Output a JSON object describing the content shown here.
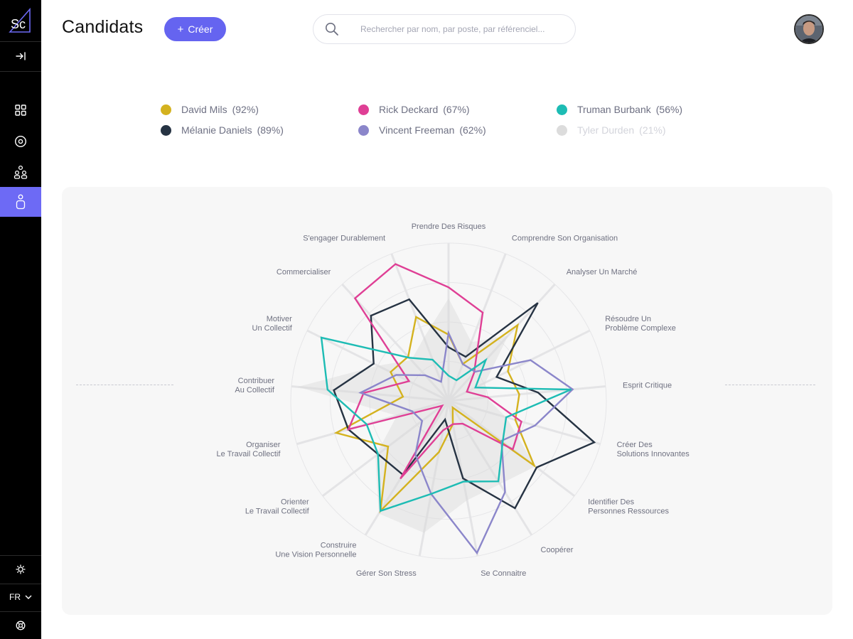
{
  "app": {
    "logo_text": "Sc"
  },
  "header": {
    "title": "Candidats",
    "create_label": "Créer",
    "search_placeholder": "Rechercher par nom, par poste, par référenciel..."
  },
  "sidebar": {
    "language": "FR",
    "items": [
      {
        "name": "collapse",
        "icon": "collapse-arrow-icon"
      },
      {
        "name": "dashboard",
        "icon": "grid-icon"
      },
      {
        "name": "target",
        "icon": "target-icon"
      },
      {
        "name": "team",
        "icon": "team-icon"
      },
      {
        "name": "candidates",
        "icon": "person-icon",
        "active": true
      }
    ],
    "bottom": [
      {
        "name": "settings",
        "icon": "gear-icon"
      },
      {
        "name": "support",
        "icon": "lifebuoy-icon"
      }
    ]
  },
  "colors": {
    "accent": "#6564f0",
    "sidebar_bg": "#000000",
    "panel_bg": "#f7f7f7"
  },
  "chart_data": {
    "type": "radar",
    "axes": [
      "Prendre Des Risques",
      "Comprendre Son Organisation",
      "Analyser Un Marché",
      "Résoudre Un|Problème Complexe",
      "Esprit Critique",
      "Créer Des|Solutions Innovantes",
      "Identifier Des|Personnes Ressources",
      "Coopérer",
      "Se Connaitre",
      "Gérer Son Stress",
      "Construire|Une Vision Personnelle",
      "Orienter|Le Travail Collectif",
      "Organiser|Le Travail  Collectif",
      "Contribuer|Au Collectif",
      "Motiver|Un Collectif",
      "Commercialiser",
      "S'engager Durablement"
    ],
    "rmax": 10,
    "grid_rings": [
      2.5,
      5,
      7.5,
      10
    ],
    "series": [
      {
        "name": "David Mils",
        "score": "(92%)",
        "color": "#d4b21f",
        "visible": true,
        "values": [
          4.2,
          2.5,
          6.5,
          4.2,
          4.5,
          4.4,
          6.8,
          0.5,
          1.5,
          3.3,
          8.2,
          4.8,
          7.4,
          2.9,
          4.1,
          3.8,
          5.7
        ]
      },
      {
        "name": "Mélanie Daniels",
        "score": "(89%)",
        "color": "#263343",
        "visible": true,
        "values": [
          3.4,
          3.0,
          8.4,
          3.4,
          5.7,
          9.6,
          7.0,
          8.0,
          5.0,
          1.2,
          5.5,
          5.6,
          6.6,
          7.3,
          5.3,
          7.3,
          6.9
        ]
      },
      {
        "name": "Rick Deckard",
        "score": "(67%)",
        "color": "#df3f95",
        "visible": true,
        "values": [
          7.2,
          6.0,
          2.4,
          1.3,
          2.5,
          4.8,
          5.1,
          1.7,
          1.5,
          1.9,
          5.8,
          0.5,
          6.6,
          5.4,
          2.8,
          8.8,
          9.3
        ]
      },
      {
        "name": "Vincent Freeman",
        "score": "(62%)",
        "color": "#8b86ca",
        "visible": true,
        "values": [
          4.3,
          2.5,
          2.5,
          5.8,
          7.9,
          5.7,
          4.2,
          6.8,
          9.8,
          6.0,
          4.0,
          2.1,
          2.4,
          5.6,
          3.7,
          2.2,
          1.3
        ]
      },
      {
        "name": "Truman Burbank",
        "score": "(56%)",
        "color": "#1dbcb4",
        "visible": true,
        "values": [
          1.6,
          1.4,
          3.5,
          1.9,
          7.8,
          3.8,
          4.3,
          6.0,
          5.2,
          6.0,
          8.2,
          5.6,
          5.4,
          7.7,
          9.0,
          3.7,
          2.8
        ]
      },
      {
        "name": "Tyler Durden",
        "score": "(21%)",
        "color": "#dcdcdc",
        "visible": false,
        "values": [
          6.5,
          4.0,
          5.6,
          2.6,
          2.4,
          3.8,
          6.9,
          6.2,
          6.4,
          8.5,
          8.4,
          5.8,
          3.4,
          9.6,
          5.0,
          3.5,
          4.3
        ]
      }
    ]
  }
}
